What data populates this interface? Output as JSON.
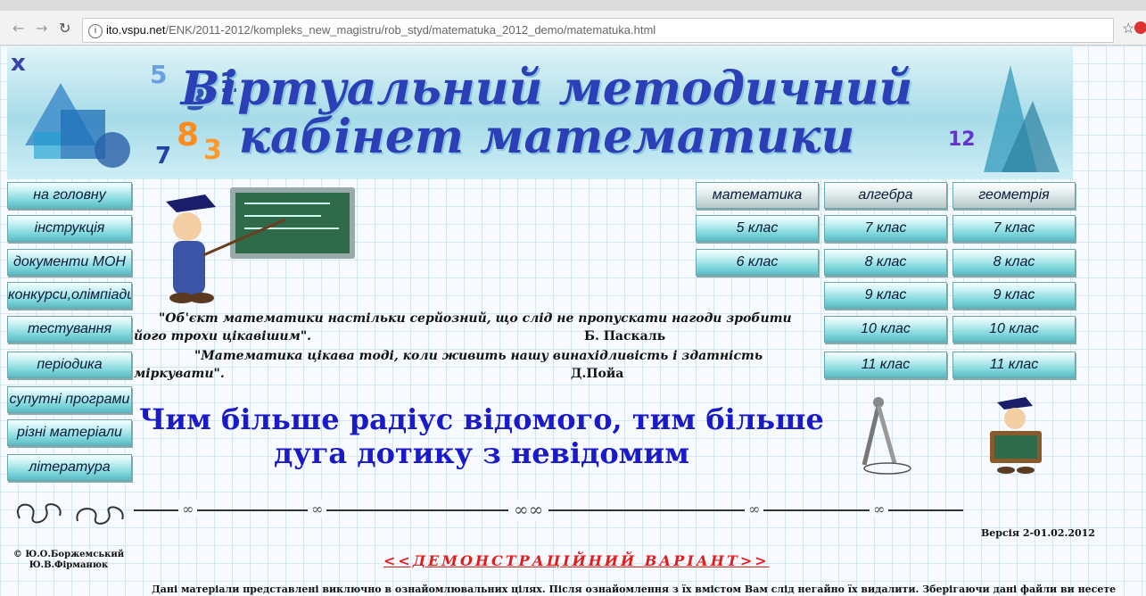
{
  "browser": {
    "url_host": "ito.vspu.net",
    "url_path": "/ENK/2011-2012/kompleks_new_magistru/rob_styd/matematuka_2012_demo/matematuka.html",
    "back_icon": "arrow-left-icon",
    "forward_icon": "arrow-right-icon",
    "reload_icon": "reload-icon",
    "bookmark_icon": "star-icon"
  },
  "banner": {
    "line1": "Віртуальний методичний",
    "line2": "кабінет математики"
  },
  "left_menu": [
    "на головну",
    "інструкція",
    "документи МОН",
    "конкурси,олімпіади",
    "тестування",
    "періодика",
    "супутні програми",
    "різні матеріали",
    "література"
  ],
  "subjects": {
    "matematika": {
      "title": "математика",
      "items": [
        "5 клас",
        "6 клас"
      ]
    },
    "algebra": {
      "title": "алгебра",
      "items": [
        "7 клас",
        "8 клас",
        "9 клас",
        "10 клас",
        "11 клас"
      ]
    },
    "geometriia": {
      "title": "геометрія",
      "items": [
        "7 клас",
        "8 клас",
        "9 клас",
        "10 клас",
        "11 клас"
      ]
    }
  },
  "quotes": [
    {
      "line1": "\"Об'єкт  математики  настільки серйозний, що слід не пропускати нагоди зробити",
      "line2": "його трохи цікавішим\".",
      "author": "Б. Паскаль"
    },
    {
      "line1": "\"Математика цікава тоді, коли живить   нашу   винахідливість   і здатність",
      "line2": "міркувати\".",
      "author": "Д.Пойа"
    }
  ],
  "motto": {
    "line1": "Чим більше радіус відомого, тим більше",
    "line2": "дуга дотику з невідомим"
  },
  "footer": {
    "version": "Версія 2-01.02.2012",
    "demo_link": "<<ДЕМОНСТРАЦІЙНИЙ ВАРІАНТ>>",
    "copyright_line1": "© Ю.О.Боржемський",
    "copyright_line2": "Ю.В.Фірманюк",
    "disclaimer": "Дані матеріали представлені виключно в ознайомлювальних цілях. Після ознайомлення з їх вмістом Вам слід негайно їх видалити. Зберігаючи дані файли ви несете"
  },
  "colors": {
    "accent_blue": "#2b3fb6",
    "motto_blue": "#1a1ac8",
    "demo_red": "#e21b1b",
    "button_cyan": "#7fd7dc"
  }
}
